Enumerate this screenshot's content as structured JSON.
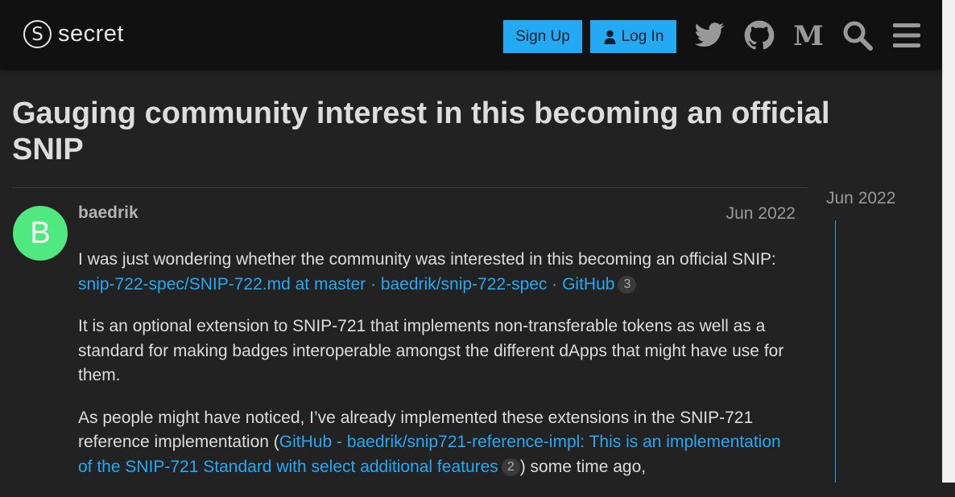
{
  "header": {
    "logo_text": "secret",
    "signup_label": "Sign Up",
    "login_label": "Log In"
  },
  "topic": {
    "title": "Gauging community interest in this becoming an official SNIP"
  },
  "post": {
    "avatar_letter": "B",
    "avatar_color": "#4fe97f",
    "username": "baedrik",
    "date": "Jun 2022",
    "p1_text": "I was just wondering whether the community was interested in this becoming an official SNIP: ",
    "p1_link": "snip-722-spec/SNIP-722.md at master · baedrik/snip-722-spec · GitHub",
    "p1_link_count": "3",
    "p2_text": "It is an optional extension to SNIP-721 that implements non-transferable tokens as well as a standard for making badges interoperable amongst the different dApps that might have use for them.",
    "p3_text_before": "As people might have noticed, I’ve already implemented these extensions in the SNIP-721 reference implementation (",
    "p3_link": "GitHub - baedrik/snip721-reference-impl: This is an implementation of the SNIP-721 Standard with select additional features",
    "p3_link_count": "2",
    "p3_text_after": ") some time ago,"
  },
  "timeline": {
    "date": "Jun 2022"
  },
  "colors": {
    "accent": "#24a9f5",
    "background": "#222222",
    "header_background": "#111111"
  },
  "icons": [
    "twitter-icon",
    "github-icon",
    "medium-icon",
    "search-icon",
    "menu-icon"
  ]
}
